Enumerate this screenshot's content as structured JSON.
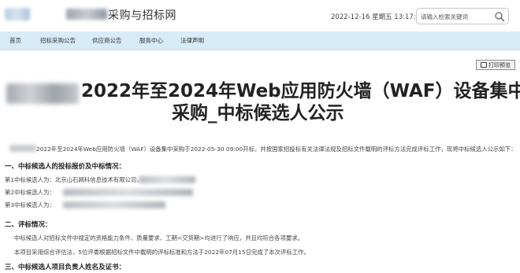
{
  "header": {
    "site_title": "采购与招标网",
    "datetime": "2022-12-16 星期五 13:17:05",
    "search_placeholder": "请输入检索关键词"
  },
  "nav": {
    "items": [
      "首页",
      "招标采购公告",
      "供应商公告",
      "服务中心",
      "法律声明"
    ]
  },
  "toolbar": {
    "print_label": "打印预览"
  },
  "article": {
    "title_line1": "2022年至2024年Web应用防火墙（WAF）设备集中",
    "title_line2": "采购_中标候选人公示",
    "intro": "2022年至2024年Web应用防火墙（WAF）设备集中采购于2022-05-30 09:00开标，并按国家招投标有关法律法规及招标文件载明的评标方法完成评标工作，现将中标候选人公示如下：",
    "section1_heading": "一、中标候选人的投标报价及中标情况：",
    "candidates": [
      {
        "label": "第1中标候选人为：",
        "value": "北京山石网科信息技术有限公司，"
      },
      {
        "label": "第2中标候选人为：",
        "value": ""
      },
      {
        "label": "第3中标候选人为：",
        "value": ""
      }
    ],
    "section2_heading": "二、评标情况：",
    "section2_para1": "中标候选人对招标文件中规定的资格能力条件、质量要求、工期<交货期>均进行了响应，并且均符合各项要求。",
    "section2_para2": "本项目采用综合评估法，5位评委根据招标文件中载明的评标标准和方法于2022年07月15日完成了本次评标工作。",
    "section3_heading": "三、中标候选人项目负责人姓名及证书："
  }
}
